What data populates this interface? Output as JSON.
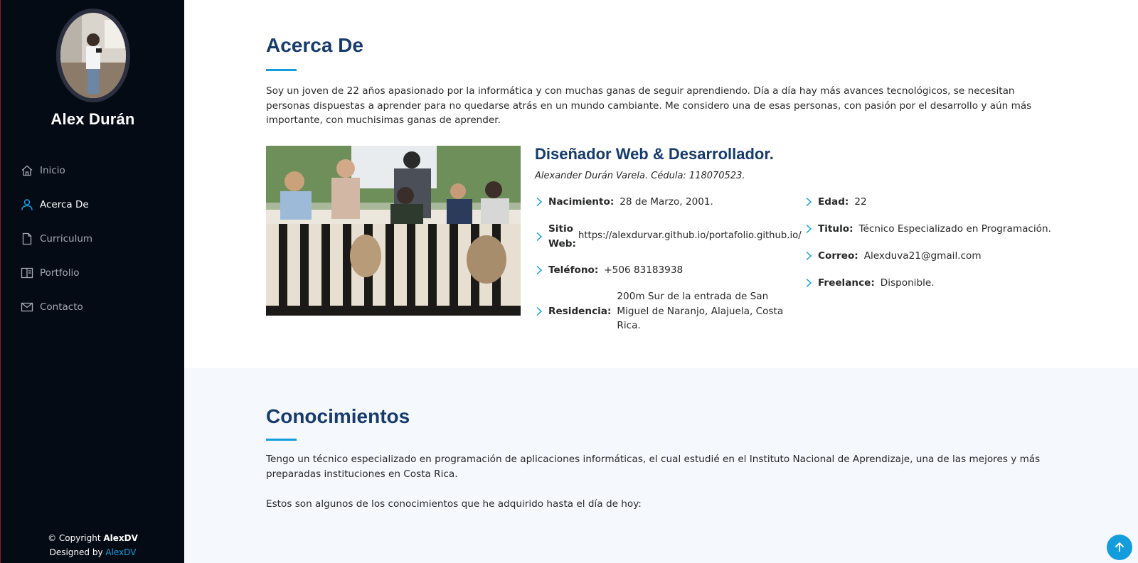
{
  "sidebar": {
    "profile_name": "Alex Durán",
    "nav": [
      {
        "label": "Inicio",
        "icon": "home-icon",
        "active": false
      },
      {
        "label": "Acerca De",
        "icon": "person-icon",
        "active": true
      },
      {
        "label": "Curriculum",
        "icon": "file-icon",
        "active": false
      },
      {
        "label": "Portfolio",
        "icon": "book-icon",
        "active": false
      },
      {
        "label": "Contacto",
        "icon": "envelope-icon",
        "active": false
      }
    ],
    "footer": {
      "copyright_prefix": "© Copyright ",
      "copyright_brand": "AlexDV",
      "designed_prefix": "Designed by ",
      "designed_link": "AlexDV"
    }
  },
  "about": {
    "title": "Acerca De",
    "intro": "Soy un joven de 22 años apasionado por la informática y con muchas ganas de seguir aprendiendo. Día a día hay más avances tecnológicos, se necesitan personas dispuestas a aprender para no quedarse atrás en un mundo cambiante. Me considero una de esas personas, con pasión por el desarrollo y aún más importante, con muchisimas ganas de aprender.",
    "role_title": "Diseñador Web & Desarrollador.",
    "role_subtitle": "Alexander Durán Varela. Cédula: 118070523.",
    "info_left": [
      {
        "key": "Nacimiento:",
        "value": "28 de Marzo, 2001."
      },
      {
        "key": "Sitio Web:",
        "value": "https://alexdurvar.github.io/portafolio.github.io/"
      },
      {
        "key": "Teléfono:",
        "value": "+506 83183938"
      },
      {
        "key": "Residencia:",
        "value": "200m Sur de la entrada de San Miguel de Naranjo, Alajuela, Costa Rica."
      }
    ],
    "info_right": [
      {
        "key": "Edad:",
        "value": "22"
      },
      {
        "key": "Titulo:",
        "value": "Técnico Especializado en Programación."
      },
      {
        "key": "Correo:",
        "value": "Alexduva21@gmail.com"
      },
      {
        "key": "Freelance:",
        "value": "Disponible."
      }
    ]
  },
  "skills": {
    "title": "Conocimientos",
    "paragraph1": "Tengo un técnico especializado en programación de aplicaciones informáticas, el cual estudié en el Instituto Nacional de Aprendizaje, una de las mejores y más preparadas instituciones en Costa Rica.",
    "paragraph2": "Estos son algunos de los conocimientos que he adquirido hasta el día de hoy:"
  },
  "colors": {
    "sidebar_bg": "#040b14",
    "accent": "#149ddd",
    "heading": "#173b6c",
    "skills_bg": "#f5f8fd"
  },
  "scroll_top_icon": "arrow-up-icon"
}
